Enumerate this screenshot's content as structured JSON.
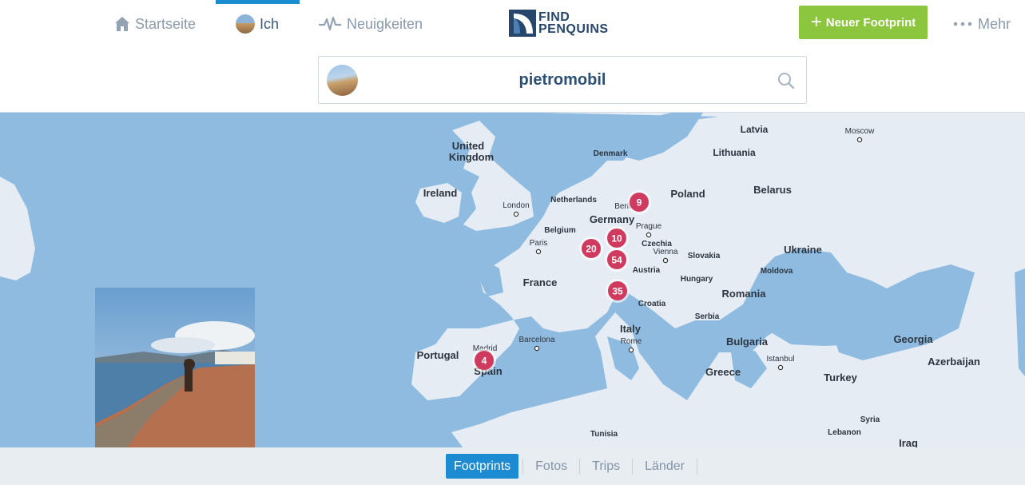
{
  "nav": {
    "home_label": "Startseite",
    "me_label": "Ich",
    "news_label": "Neuigkeiten",
    "more_label": "Mehr"
  },
  "logo": {
    "line1": "FIND",
    "line2": "PENQUINS"
  },
  "new_footprint_label": "Neuer Footprint",
  "profile": {
    "username": "pietromobil"
  },
  "map": {
    "countries": [
      "United Kingdom",
      "Ireland",
      "Netherlands",
      "Belgium",
      "Germany",
      "Poland",
      "Latvia",
      "Lithuania",
      "Belarus",
      "Ukraine",
      "Moldova",
      "Czechia",
      "Slovakia",
      "Austria",
      "Hungary",
      "Romania",
      "France",
      "Croatia",
      "Serbia",
      "Italy",
      "Bulgaria",
      "Greece",
      "Turkey",
      "Georgia",
      "Azerbaijan",
      "Syria",
      "Lebanon",
      "Iraq",
      "Portugal",
      "Spain",
      "Tunisia",
      "Denmark"
    ],
    "cities": [
      "London",
      "Paris",
      "Berlin",
      "Prague",
      "Vienna",
      "Moscow",
      "Barcelona",
      "Madrid",
      "Rome",
      "Istanbul"
    ],
    "clusters": [
      {
        "count": "9",
        "label": "Berlin"
      },
      {
        "count": "10",
        "label": "Germany"
      },
      {
        "count": "20",
        "label": "France"
      },
      {
        "count": "54",
        "label": "Austria"
      },
      {
        "count": "35",
        "label": "Italy"
      },
      {
        "count": "4",
        "label": "Madrid"
      }
    ],
    "colors": {
      "sea": "#8fbbe0",
      "land": "#e5ecf3",
      "cluster": "#d03a5e"
    }
  },
  "tabs": [
    {
      "label": "Footprints",
      "active": true
    },
    {
      "label": "Fotos",
      "active": false
    },
    {
      "label": "Trips",
      "active": false
    },
    {
      "label": "Länder",
      "active": false
    }
  ],
  "icons": {
    "home": "home-icon",
    "activity": "activity-icon",
    "search": "search-icon",
    "plus": "plus-icon",
    "more": "more-dots-icon",
    "settings": "gear-icon"
  }
}
